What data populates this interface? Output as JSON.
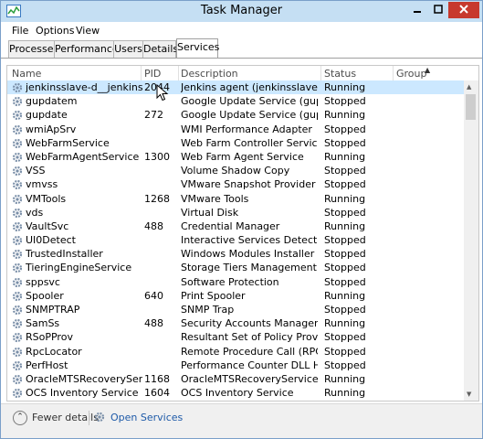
{
  "window": {
    "title": "Task Manager"
  },
  "menubar": [
    "File",
    "Options",
    "View"
  ],
  "tabs": [
    {
      "label": "Processes"
    },
    {
      "label": "Performance"
    },
    {
      "label": "Users"
    },
    {
      "label": "Details"
    },
    {
      "label": "Services",
      "active": true
    }
  ],
  "columns": {
    "name": "Name",
    "pid": "PID",
    "description": "Description",
    "status": "Status",
    "group": "Group"
  },
  "rows": [
    {
      "name": "jenkinsslave-d__jenkinsagent",
      "pid": "2044",
      "description": "Jenkins agent (jenkinsslave-d__je...",
      "status": "Running",
      "selected": true
    },
    {
      "name": "gupdatem",
      "pid": "",
      "description": "Google Update Service (gupdate...",
      "status": "Stopped"
    },
    {
      "name": "gupdate",
      "pid": "272",
      "description": "Google Update Service (gupdate)",
      "status": "Running"
    },
    {
      "name": "wmiApSrv",
      "pid": "",
      "description": "WMI Performance Adapter",
      "status": "Stopped"
    },
    {
      "name": "WebFarmService",
      "pid": "",
      "description": "Web Farm Controller Service",
      "status": "Stopped"
    },
    {
      "name": "WebFarmAgentService",
      "pid": "1300",
      "description": "Web Farm Agent Service",
      "status": "Running"
    },
    {
      "name": "VSS",
      "pid": "",
      "description": "Volume Shadow Copy",
      "status": "Stopped"
    },
    {
      "name": "vmvss",
      "pid": "",
      "description": "VMware Snapshot Provider",
      "status": "Stopped"
    },
    {
      "name": "VMTools",
      "pid": "1268",
      "description": "VMware Tools",
      "status": "Running"
    },
    {
      "name": "vds",
      "pid": "",
      "description": "Virtual Disk",
      "status": "Stopped"
    },
    {
      "name": "VaultSvc",
      "pid": "488",
      "description": "Credential Manager",
      "status": "Running"
    },
    {
      "name": "UI0Detect",
      "pid": "",
      "description": "Interactive Services Detection",
      "status": "Stopped"
    },
    {
      "name": "TrustedInstaller",
      "pid": "",
      "description": "Windows Modules Installer",
      "status": "Stopped"
    },
    {
      "name": "TieringEngineService",
      "pid": "",
      "description": "Storage Tiers Management",
      "status": "Stopped"
    },
    {
      "name": "sppsvc",
      "pid": "",
      "description": "Software Protection",
      "status": "Stopped"
    },
    {
      "name": "Spooler",
      "pid": "640",
      "description": "Print Spooler",
      "status": "Running"
    },
    {
      "name": "SNMPTRAP",
      "pid": "",
      "description": "SNMP Trap",
      "status": "Stopped"
    },
    {
      "name": "SamSs",
      "pid": "488",
      "description": "Security Accounts Manager",
      "status": "Running"
    },
    {
      "name": "RSoPProv",
      "pid": "",
      "description": "Resultant Set of Policy Provider",
      "status": "Stopped"
    },
    {
      "name": "RpcLocator",
      "pid": "",
      "description": "Remote Procedure Call (RPC) Lo...",
      "status": "Stopped"
    },
    {
      "name": "PerfHost",
      "pid": "",
      "description": "Performance Counter DLL Host",
      "status": "Stopped"
    },
    {
      "name": "OracleMTSRecoveryService",
      "pid": "1168",
      "description": "OracleMTSRecoveryService",
      "status": "Running"
    },
    {
      "name": "OCS Inventory Service",
      "pid": "1604",
      "description": "OCS Inventory Service",
      "status": "Running"
    }
  ],
  "footer": {
    "fewer_details": "Fewer details",
    "open_services": "Open Services"
  },
  "colors": {
    "title_bar": "#c5dff3",
    "close_button": "#c7392d",
    "selection": "#cce8ff",
    "link": "#1e5aa8"
  },
  "icons": {
    "window": "task-manager-icon",
    "service": "service-gear-icon",
    "open_services": "services-gear-icon"
  }
}
